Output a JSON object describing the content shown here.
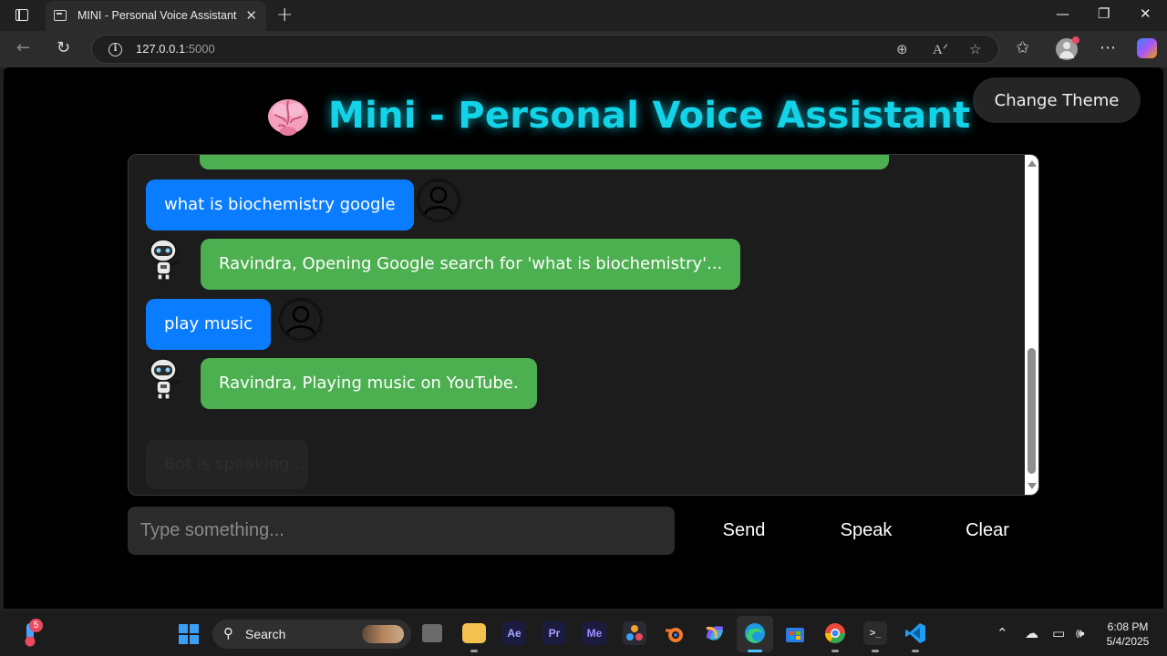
{
  "browser": {
    "tab_title": "MINI - Personal Voice Assistant",
    "url_host": "127.0.0.1",
    "url_port": ":5000"
  },
  "app": {
    "theme_button": "Change Theme",
    "heading": "Mini - Personal Voice Assistant",
    "accent_color": "#12d3e8",
    "user_bubble_color": "#0a7cff",
    "bot_bubble_color": "#4caf50"
  },
  "chat": {
    "messages": [
      {
        "role": "user",
        "text": "what is biochemistry google"
      },
      {
        "role": "bot",
        "text": "Ravindra, Opening Google search for 'what is biochemistry'..."
      },
      {
        "role": "user",
        "text": "play music"
      },
      {
        "role": "bot",
        "text": "Ravindra, Playing music on YouTube."
      }
    ],
    "faded_message": "Bot is speaking..."
  },
  "composer": {
    "placeholder": "Type something...",
    "send_label": "Send",
    "speak_label": "Speak",
    "clear_label": "Clear"
  },
  "taskbar": {
    "notification_count": "5",
    "search_label": "Search",
    "apps": [
      "Ae",
      "Pr",
      "Me"
    ],
    "time": "6:08 PM",
    "date": "5/4/2025"
  }
}
